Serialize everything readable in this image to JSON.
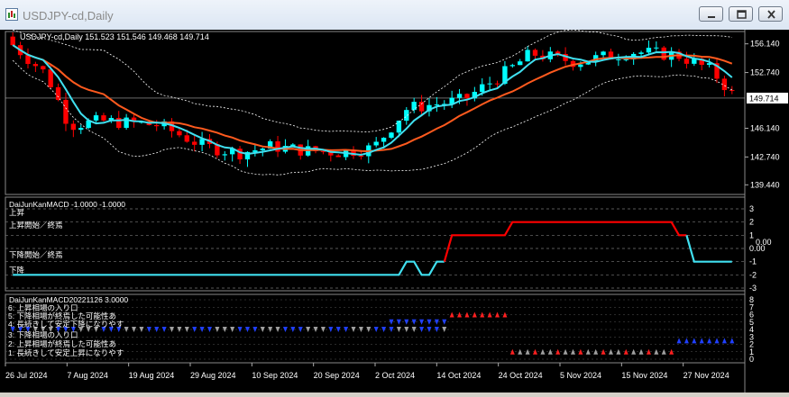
{
  "window": {
    "title": "USDJPY-cd,Daily",
    "minimize_icon": "minimize-icon",
    "restore_icon": "restore-icon",
    "close_icon": "close-icon"
  },
  "main_chart": {
    "header": "USDJPY-cd,Daily  151.523 151.546 149.468 149.714",
    "price_labels": [
      "156.140",
      "152.740",
      "146.140",
      "142.740",
      "139.440"
    ],
    "current_price": "149.714",
    "colors": {
      "bull": "#00ffff",
      "bear": "#ff0000",
      "fast_ma": "#40e0f0",
      "slow_ma": "#ff5a1e",
      "band": "#ffffff"
    }
  },
  "macd_panel": {
    "title": "DaiJunKanMACD -1.0000 -1.0000",
    "scale": [
      "3",
      "2",
      "1",
      "0.00",
      "-1",
      "-2",
      "-3"
    ],
    "zero_label": "0.00",
    "labels": [
      "上昇",
      "上昇開始／終焉",
      "下降開始／終焉",
      "下降"
    ],
    "colors": {
      "up": "#ff0000",
      "down": "#40e0f0"
    }
  },
  "signal_panel": {
    "title": "DaiJunKanMACD20221126 3.0000",
    "scale": [
      "8",
      "7",
      "6",
      "5",
      "4",
      "3",
      "2",
      "1",
      "0"
    ],
    "labels": [
      "6: 上昇相場の入り口",
      "5: 下降相場が終焉した可能性あ",
      "4: 長続きして安定下降になりやす",
      "3: 下降相場の入り口",
      "2: 上昇相場が終焉した可能性あ",
      "1: 長続きして安定上昇になりやす"
    ]
  },
  "time_axis": [
    "26 Jul 2024",
    "7 Aug 2024",
    "19 Aug 2024",
    "29 Aug 2024",
    "10 Sep 2024",
    "20 Sep 2024",
    "2 Oct 2024",
    "14 Oct 2024",
    "24 Oct 2024",
    "5 Nov 2024",
    "15 Nov 2024",
    "27 Nov 2024"
  ]
}
